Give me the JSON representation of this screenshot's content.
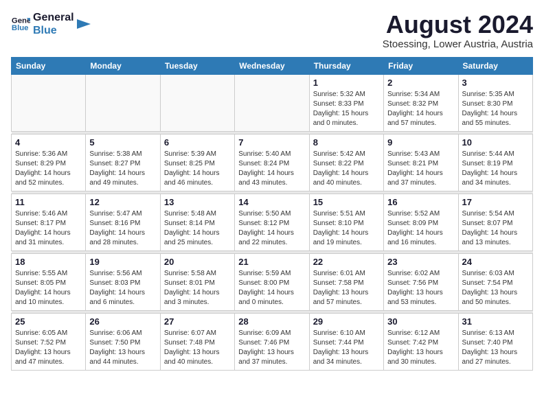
{
  "logo": {
    "line1": "General",
    "line2": "Blue"
  },
  "title": "August 2024",
  "subtitle": "Stoessing, Lower Austria, Austria",
  "days_of_week": [
    "Sunday",
    "Monday",
    "Tuesday",
    "Wednesday",
    "Thursday",
    "Friday",
    "Saturday"
  ],
  "weeks": [
    [
      {
        "day": "",
        "info": ""
      },
      {
        "day": "",
        "info": ""
      },
      {
        "day": "",
        "info": ""
      },
      {
        "day": "",
        "info": ""
      },
      {
        "day": "1",
        "info": "Sunrise: 5:32 AM\nSunset: 8:33 PM\nDaylight: 15 hours\nand 0 minutes."
      },
      {
        "day": "2",
        "info": "Sunrise: 5:34 AM\nSunset: 8:32 PM\nDaylight: 14 hours\nand 57 minutes."
      },
      {
        "day": "3",
        "info": "Sunrise: 5:35 AM\nSunset: 8:30 PM\nDaylight: 14 hours\nand 55 minutes."
      }
    ],
    [
      {
        "day": "4",
        "info": "Sunrise: 5:36 AM\nSunset: 8:29 PM\nDaylight: 14 hours\nand 52 minutes."
      },
      {
        "day": "5",
        "info": "Sunrise: 5:38 AM\nSunset: 8:27 PM\nDaylight: 14 hours\nand 49 minutes."
      },
      {
        "day": "6",
        "info": "Sunrise: 5:39 AM\nSunset: 8:25 PM\nDaylight: 14 hours\nand 46 minutes."
      },
      {
        "day": "7",
        "info": "Sunrise: 5:40 AM\nSunset: 8:24 PM\nDaylight: 14 hours\nand 43 minutes."
      },
      {
        "day": "8",
        "info": "Sunrise: 5:42 AM\nSunset: 8:22 PM\nDaylight: 14 hours\nand 40 minutes."
      },
      {
        "day": "9",
        "info": "Sunrise: 5:43 AM\nSunset: 8:21 PM\nDaylight: 14 hours\nand 37 minutes."
      },
      {
        "day": "10",
        "info": "Sunrise: 5:44 AM\nSunset: 8:19 PM\nDaylight: 14 hours\nand 34 minutes."
      }
    ],
    [
      {
        "day": "11",
        "info": "Sunrise: 5:46 AM\nSunset: 8:17 PM\nDaylight: 14 hours\nand 31 minutes."
      },
      {
        "day": "12",
        "info": "Sunrise: 5:47 AM\nSunset: 8:16 PM\nDaylight: 14 hours\nand 28 minutes."
      },
      {
        "day": "13",
        "info": "Sunrise: 5:48 AM\nSunset: 8:14 PM\nDaylight: 14 hours\nand 25 minutes."
      },
      {
        "day": "14",
        "info": "Sunrise: 5:50 AM\nSunset: 8:12 PM\nDaylight: 14 hours\nand 22 minutes."
      },
      {
        "day": "15",
        "info": "Sunrise: 5:51 AM\nSunset: 8:10 PM\nDaylight: 14 hours\nand 19 minutes."
      },
      {
        "day": "16",
        "info": "Sunrise: 5:52 AM\nSunset: 8:09 PM\nDaylight: 14 hours\nand 16 minutes."
      },
      {
        "day": "17",
        "info": "Sunrise: 5:54 AM\nSunset: 8:07 PM\nDaylight: 14 hours\nand 13 minutes."
      }
    ],
    [
      {
        "day": "18",
        "info": "Sunrise: 5:55 AM\nSunset: 8:05 PM\nDaylight: 14 hours\nand 10 minutes."
      },
      {
        "day": "19",
        "info": "Sunrise: 5:56 AM\nSunset: 8:03 PM\nDaylight: 14 hours\nand 6 minutes."
      },
      {
        "day": "20",
        "info": "Sunrise: 5:58 AM\nSunset: 8:01 PM\nDaylight: 14 hours\nand 3 minutes."
      },
      {
        "day": "21",
        "info": "Sunrise: 5:59 AM\nSunset: 8:00 PM\nDaylight: 14 hours\nand 0 minutes."
      },
      {
        "day": "22",
        "info": "Sunrise: 6:01 AM\nSunset: 7:58 PM\nDaylight: 13 hours\nand 57 minutes."
      },
      {
        "day": "23",
        "info": "Sunrise: 6:02 AM\nSunset: 7:56 PM\nDaylight: 13 hours\nand 53 minutes."
      },
      {
        "day": "24",
        "info": "Sunrise: 6:03 AM\nSunset: 7:54 PM\nDaylight: 13 hours\nand 50 minutes."
      }
    ],
    [
      {
        "day": "25",
        "info": "Sunrise: 6:05 AM\nSunset: 7:52 PM\nDaylight: 13 hours\nand 47 minutes."
      },
      {
        "day": "26",
        "info": "Sunrise: 6:06 AM\nSunset: 7:50 PM\nDaylight: 13 hours\nand 44 minutes."
      },
      {
        "day": "27",
        "info": "Sunrise: 6:07 AM\nSunset: 7:48 PM\nDaylight: 13 hours\nand 40 minutes."
      },
      {
        "day": "28",
        "info": "Sunrise: 6:09 AM\nSunset: 7:46 PM\nDaylight: 13 hours\nand 37 minutes."
      },
      {
        "day": "29",
        "info": "Sunrise: 6:10 AM\nSunset: 7:44 PM\nDaylight: 13 hours\nand 34 minutes."
      },
      {
        "day": "30",
        "info": "Sunrise: 6:12 AM\nSunset: 7:42 PM\nDaylight: 13 hours\nand 30 minutes."
      },
      {
        "day": "31",
        "info": "Sunrise: 6:13 AM\nSunset: 7:40 PM\nDaylight: 13 hours\nand 27 minutes."
      }
    ]
  ]
}
